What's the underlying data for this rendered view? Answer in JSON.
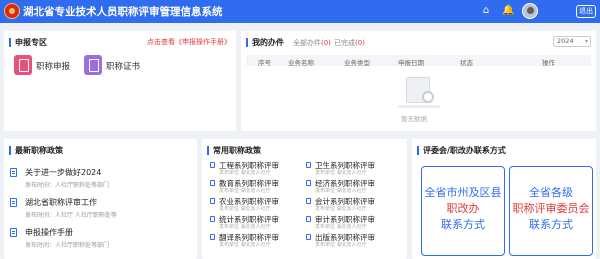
{
  "header": {
    "title": "湖北省专业技术人员职称评审管理信息系统",
    "user_name": "",
    "exit_label": "退出",
    "icons": [
      "home-icon",
      "bell-icon",
      "avatar"
    ],
    "colors": {
      "brand": "#2f6cf0",
      "alert": "#e03a3a"
    }
  },
  "apply_zone": {
    "title": "申报专区",
    "guide_link": "点击查看《申报操作手册》",
    "buttons": [
      {
        "label": "职称申报",
        "icon": "file-icon",
        "color": "#e8517a"
      },
      {
        "label": "职称证书",
        "icon": "certificate-icon",
        "color": "#9b6fe0"
      }
    ]
  },
  "my_tasks": {
    "title": "我的办件",
    "tabs": [
      {
        "label": "全部办件",
        "count": "(0)"
      },
      {
        "label": "已完成",
        "count": "(0)"
      }
    ],
    "year": "2024",
    "columns": [
      "序号",
      "业务名称",
      "业务类型",
      "申报日期",
      "状态",
      "操作"
    ],
    "empty_text": "暂无数据"
  },
  "latest_policy": {
    "title": "最新职称政策",
    "items": [
      {
        "title": "关于进一步做好2024",
        "sub": "发布时间：人社厅职称处等部门"
      },
      {
        "title": "湖北省职称评审工作",
        "sub": "发布时间：人社厅 人社厅职称处等"
      },
      {
        "title": "申报操作手册",
        "sub": "发布时间：人社厅职称处等部门"
      }
    ]
  },
  "common_policy": {
    "title": "常用职称政策",
    "items": [
      {
        "title": "工程系列职称评审",
        "sub": "发布单位 湖北省人社厅"
      },
      {
        "title": "卫生系列职称评审",
        "sub": "发布单位 湖北省人社厅"
      },
      {
        "title": "教育系列职称评审",
        "sub": "发布单位 湖北省人社厅"
      },
      {
        "title": "经济系列职称评审",
        "sub": "发布单位 湖北省人社厅"
      },
      {
        "title": "农业系列职称评审",
        "sub": "发布单位 湖北省人社厅"
      },
      {
        "title": "会计系列职称评审",
        "sub": "发布单位 湖北省人社厅"
      },
      {
        "title": "统计系列职称评审",
        "sub": "发布单位 湖北省人社厅"
      },
      {
        "title": "审计系列职称评审",
        "sub": "发布单位 湖北省人社厅"
      },
      {
        "title": "翻译系列职称评审",
        "sub": "发布单位 湖北省人社厅"
      },
      {
        "title": "出版系列职称评审",
        "sub": "发布单位 湖北省人社厅"
      }
    ]
  },
  "contacts": {
    "title": "评委会/职改办联系方式",
    "cards": [
      {
        "lines": [
          "全省市州及区县",
          "职改办",
          "联系方式"
        ]
      },
      {
        "lines": [
          "全省各级",
          "职称评审委员会",
          "联系方式"
        ]
      }
    ]
  }
}
